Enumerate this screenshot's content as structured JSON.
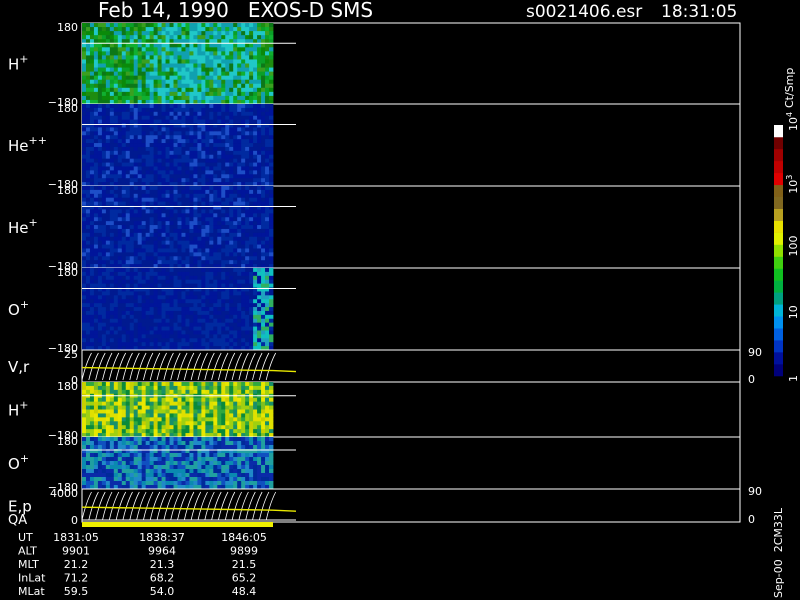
{
  "header": {
    "title": "Feb 14, 1990   EXOS-D SMS",
    "file": "s0021406.esr",
    "time": "18:31:05"
  },
  "side": {
    "stamp": "Sep-00  2CM33L"
  },
  "colorbar": {
    "unit": "Ct/Smp",
    "colors": [
      "#00007a",
      "#00109c",
      "#0034c4",
      "#0060e0",
      "#0090f0",
      "#00b4d8",
      "#00a080",
      "#00b040",
      "#10c020",
      "#40d010",
      "#90e000",
      "#e0f000",
      "#e8e000",
      "#b8a020",
      "#806820",
      "#806018",
      "#e00000",
      "#c00000",
      "#a00000",
      "#700000",
      "#ffffff"
    ],
    "labels": [
      {
        "pos": 0.0,
        "main": "1",
        "sup": ""
      },
      {
        "pos": 0.25,
        "main": "10",
        "sup": ""
      },
      {
        "pos": 0.5,
        "main": "100",
        "sup": ""
      },
      {
        "pos": 0.75,
        "main": "10",
        "sup": "3"
      },
      {
        "pos": 1.0,
        "main": "10",
        "sup": "4"
      }
    ]
  },
  "chart_data": {
    "type": "heatmap",
    "x_ticks": [
      "1831:05",
      "1838:37",
      "1846:05"
    ],
    "panels": [
      {
        "label": "H",
        "sup": "+",
        "ticks": [
          "180",
          "−180"
        ],
        "right_ticks": [],
        "palette": "hplus1"
      },
      {
        "label": "He",
        "sup": "++",
        "ticks": [
          "180",
          "−180"
        ],
        "right_ticks": [],
        "palette": "low"
      },
      {
        "label": "He",
        "sup": "+",
        "ticks": [
          "180",
          "−180"
        ],
        "right_ticks": [],
        "palette": "low"
      },
      {
        "label": "O",
        "sup": "+",
        "ticks": [
          "180",
          "−180"
        ],
        "right_ticks": [],
        "palette": "oplus1"
      },
      {
        "label": "V,r",
        "sup": "",
        "ticks": [
          "25",
          "0"
        ],
        "right_ticks": [
          "90",
          "0"
        ],
        "palette": "line"
      },
      {
        "label": "H",
        "sup": "+",
        "ticks": [
          "180",
          "−180"
        ],
        "right_ticks": [],
        "palette": "hplus2"
      },
      {
        "label": "O",
        "sup": "+",
        "ticks": [
          "180",
          "−180"
        ],
        "right_ticks": [],
        "palette": "oplus2"
      },
      {
        "label": "E,p",
        "sup": "",
        "ticks": [
          "4000",
          "0"
        ],
        "right_ticks": [
          "90",
          "0"
        ],
        "palette": "line"
      }
    ],
    "qa_label": "QA",
    "ephemeris": [
      {
        "label": "UT",
        "values": [
          "1831:05",
          "1838:37",
          "1846:05"
        ]
      },
      {
        "label": "ALT",
        "values": [
          "9901",
          "9964",
          "9899"
        ]
      },
      {
        "label": "MLT",
        "values": [
          "21.2",
          "21.3",
          "21.5"
        ]
      },
      {
        "label": "InLat",
        "values": [
          "71.2",
          "68.2",
          "65.2"
        ]
      },
      {
        "label": "MLat",
        "values": [
          "59.5",
          "54.0",
          "48.4"
        ]
      }
    ]
  }
}
